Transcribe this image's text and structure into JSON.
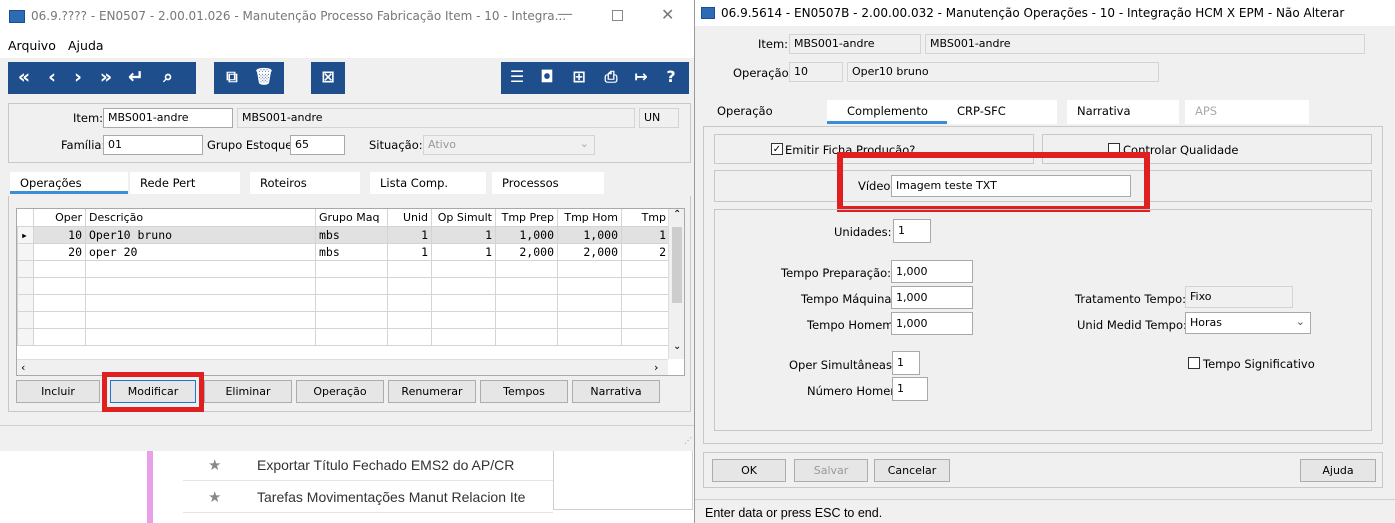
{
  "left_window": {
    "title": "06.9.???? - EN0507 - 2.00.01.026 - Manutenção Processo Fabricação Item - 10 - Integra...",
    "menu": [
      "Arquivo",
      "Ajuda"
    ],
    "item_label": "Item:",
    "item_code": "MBS001-andre",
    "item_desc": "MBS001-andre",
    "item_un": "UN",
    "familia_label": "Família:",
    "familia": "01",
    "grupo_estoque_label": "Grupo Estoque:",
    "grupo_estoque": "65",
    "situacao_label": "Situação:",
    "situacao": "Ativo",
    "tabs": [
      "Operações",
      "Rede Pert",
      "Roteiros",
      "Lista Comp.",
      "Processos"
    ],
    "columns": [
      "Oper",
      "Descrição",
      "Grupo Maq",
      "Unid",
      "Op Simult",
      "Tmp Prep",
      "Tmp Hom",
      "Tmp"
    ],
    "rows": [
      [
        "10",
        "Oper10 bruno",
        "mbs",
        "1",
        "1",
        "1,000",
        "1,000",
        "1"
      ],
      [
        "20",
        "oper 20",
        "mbs",
        "1",
        "1",
        "2,000",
        "2,000",
        "2"
      ]
    ],
    "buttons": [
      "Incluir",
      "Modificar",
      "Eliminar",
      "Operação",
      "Renumerar",
      "Tempos",
      "Narrativa"
    ]
  },
  "background_menu": {
    "items": [
      "Exportar Título Fechado EMS2 do AP/CR",
      "Tarefas Movimentações Manut Relacion Ite"
    ]
  },
  "right_window": {
    "title": "06.9.5614 - EN0507B - 2.00.00.032 - Manutenção Operações - 10 - Integração HCM X EPM - Não Alterar",
    "item_label": "Item:",
    "item_code": "MBS001-andre",
    "item_desc": "MBS001-andre",
    "operacao_label": "Operação:",
    "operacao_code": "10",
    "operacao_desc": "Oper10 bruno",
    "tabs": [
      "Operação",
      "Complemento",
      "CRP-SFC",
      "Narrativa",
      "APS"
    ],
    "emitir_ficha": "Emitir Ficha Produção?",
    "controlar_qualidade": "Controlar Qualidade",
    "video_label": "Vídeo:",
    "video_value": "Imagem teste TXT",
    "unidades_label": "Unidades:",
    "unidades": "1",
    "tempo_preparacao_label": "Tempo Preparação:",
    "tempo_preparacao": "1,000",
    "tempo_maquina_label": "Tempo Máquina:",
    "tempo_maquina": "1,000",
    "tempo_homem_label": "Tempo Homem:",
    "tempo_homem": "1,000",
    "tratamento_tempo_label": "Tratamento Tempo:",
    "tratamento_tempo": "Fixo",
    "unid_medid_tempo_label": "Unid Medid Tempo:",
    "unid_medid_tempo": "Horas",
    "oper_simultaneas_label": "Oper Simultâneas:",
    "oper_simultaneas": "1",
    "numero_homens_label": "Número Homens:",
    "numero_homens": "1",
    "tempo_significativo": "Tempo Significativo",
    "buttons": {
      "ok": "OK",
      "salvar": "Salvar",
      "cancelar": "Cancelar",
      "ajuda": "Ajuda"
    },
    "status": "Enter data or press ESC to end."
  },
  "colors": {
    "toolbar": "#1e4e8c",
    "highlight": "#e02020",
    "tab_accent": "#3c8dd8"
  }
}
